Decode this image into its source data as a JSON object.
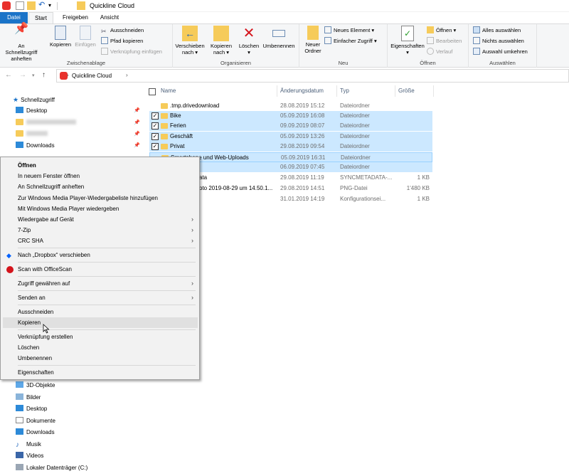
{
  "window": {
    "title": "Quickline Cloud"
  },
  "tabs": [
    {
      "label": "Datei"
    },
    {
      "label": "Start"
    },
    {
      "label": "Freigeben"
    },
    {
      "label": "Ansicht"
    }
  ],
  "ribbon": {
    "zwischenablage": {
      "label": "Zwischenablage",
      "pin_label": "An Schnellzugriff anheften",
      "copy_label": "Kopieren",
      "paste_label": "Einfügen",
      "cut_label": "Ausschneiden",
      "copy_path_label": "Pfad kopieren",
      "paste_shortcut_label": "Verknüpfung einfügen"
    },
    "organisieren": {
      "label": "Organisieren",
      "move_label": "Verschieben nach",
      "copy_to_label": "Kopieren nach",
      "delete_label": "Löschen",
      "rename_label": "Umbenennen"
    },
    "neu": {
      "label": "Neu",
      "new_folder_label": "Neuer Ordner",
      "new_item_label": "Neues Element",
      "easy_access_label": "Einfacher Zugriff"
    },
    "oeffnen": {
      "label": "Öffnen",
      "properties_label": "Eigenschaften",
      "open_label": "Öffnen",
      "edit_label": "Bearbeiten",
      "history_label": "Verlauf"
    },
    "auswaehlen": {
      "label": "Auswählen",
      "select_all_label": "Alles auswählen",
      "select_none_label": "Nichts auswählen",
      "invert_label": "Auswahl umkehren"
    }
  },
  "address": {
    "path": "Quickline Cloud"
  },
  "nav_top": [
    {
      "label": "Schnellzugriff"
    },
    {
      "label": "Desktop"
    },
    {
      "label": "Downloads"
    }
  ],
  "nav_bottom": [
    {
      "label": "3D-Objekte"
    },
    {
      "label": "Bilder"
    },
    {
      "label": "Desktop"
    },
    {
      "label": "Dokumente"
    },
    {
      "label": "Downloads"
    },
    {
      "label": "Musik"
    },
    {
      "label": "Videos"
    },
    {
      "label": "Lokaler Datenträger (C:)"
    }
  ],
  "columns": {
    "name": "Name",
    "date": "Änderungsdatum",
    "type": "Typ",
    "size": "Größe"
  },
  "files": [
    {
      "name": ".tmp.drivedownload",
      "date": "28.08.2019 15:12",
      "type": "Dateiordner",
      "size": ""
    },
    {
      "name": "Bike",
      "date": "05.09.2019 16:08",
      "type": "Dateiordner",
      "size": ""
    },
    {
      "name": "Ferien",
      "date": "09.09.2019 08:07",
      "type": "Dateiordner",
      "size": ""
    },
    {
      "name": "Geschäft",
      "date": "05.09.2019 13:26",
      "type": "Dateiordner",
      "size": ""
    },
    {
      "name": "Privat",
      "date": "29.08.2019 09:54",
      "type": "Dateiordner",
      "size": ""
    },
    {
      "name": "Smartphone und Web-Uploads",
      "date": "05.09.2019 16:31",
      "type": "Dateiordner",
      "size": ""
    },
    {
      "name": "",
      "date": "06.09.2019 07:45",
      "type": "Dateiordner",
      "size": ""
    },
    {
      "name": "ata",
      "date": "29.08.2019 11:19",
      "type": "SYNCMETADATA-...",
      "size": "1 KB"
    },
    {
      "name": "oto 2019-08-29 um 14.50.1...",
      "date": "29.08.2019 14:51",
      "type": "PNG-Datei",
      "size": "1'480 KB"
    },
    {
      "name": "",
      "date": "31.01.2019 14:19",
      "type": "Konfigurationsei...",
      "size": "1 KB"
    }
  ],
  "context_menu": [
    {
      "label": "Öffnen"
    },
    {
      "label": "In neuem Fenster öffnen"
    },
    {
      "label": "An Schnellzugriff anheften"
    },
    {
      "label": "Zur Windows Media Player-Wiedergabeliste hinzufügen"
    },
    {
      "label": "Mit Windows Media Player wiedergeben"
    },
    {
      "label": "Wiedergabe auf Gerät"
    },
    {
      "label": "7-Zip"
    },
    {
      "label": "CRC SHA"
    },
    {
      "label": "Nach „Dropbox“ verschieben"
    },
    {
      "label": "Scan with OfficeScan"
    },
    {
      "label": "Zugriff gewähren auf"
    },
    {
      "label": "Senden an"
    },
    {
      "label": "Ausschneiden"
    },
    {
      "label": "Kopieren"
    },
    {
      "label": "Verknüpfung erstellen"
    },
    {
      "label": "Löschen"
    },
    {
      "label": "Umbenennen"
    },
    {
      "label": "Eigenschaften"
    }
  ]
}
